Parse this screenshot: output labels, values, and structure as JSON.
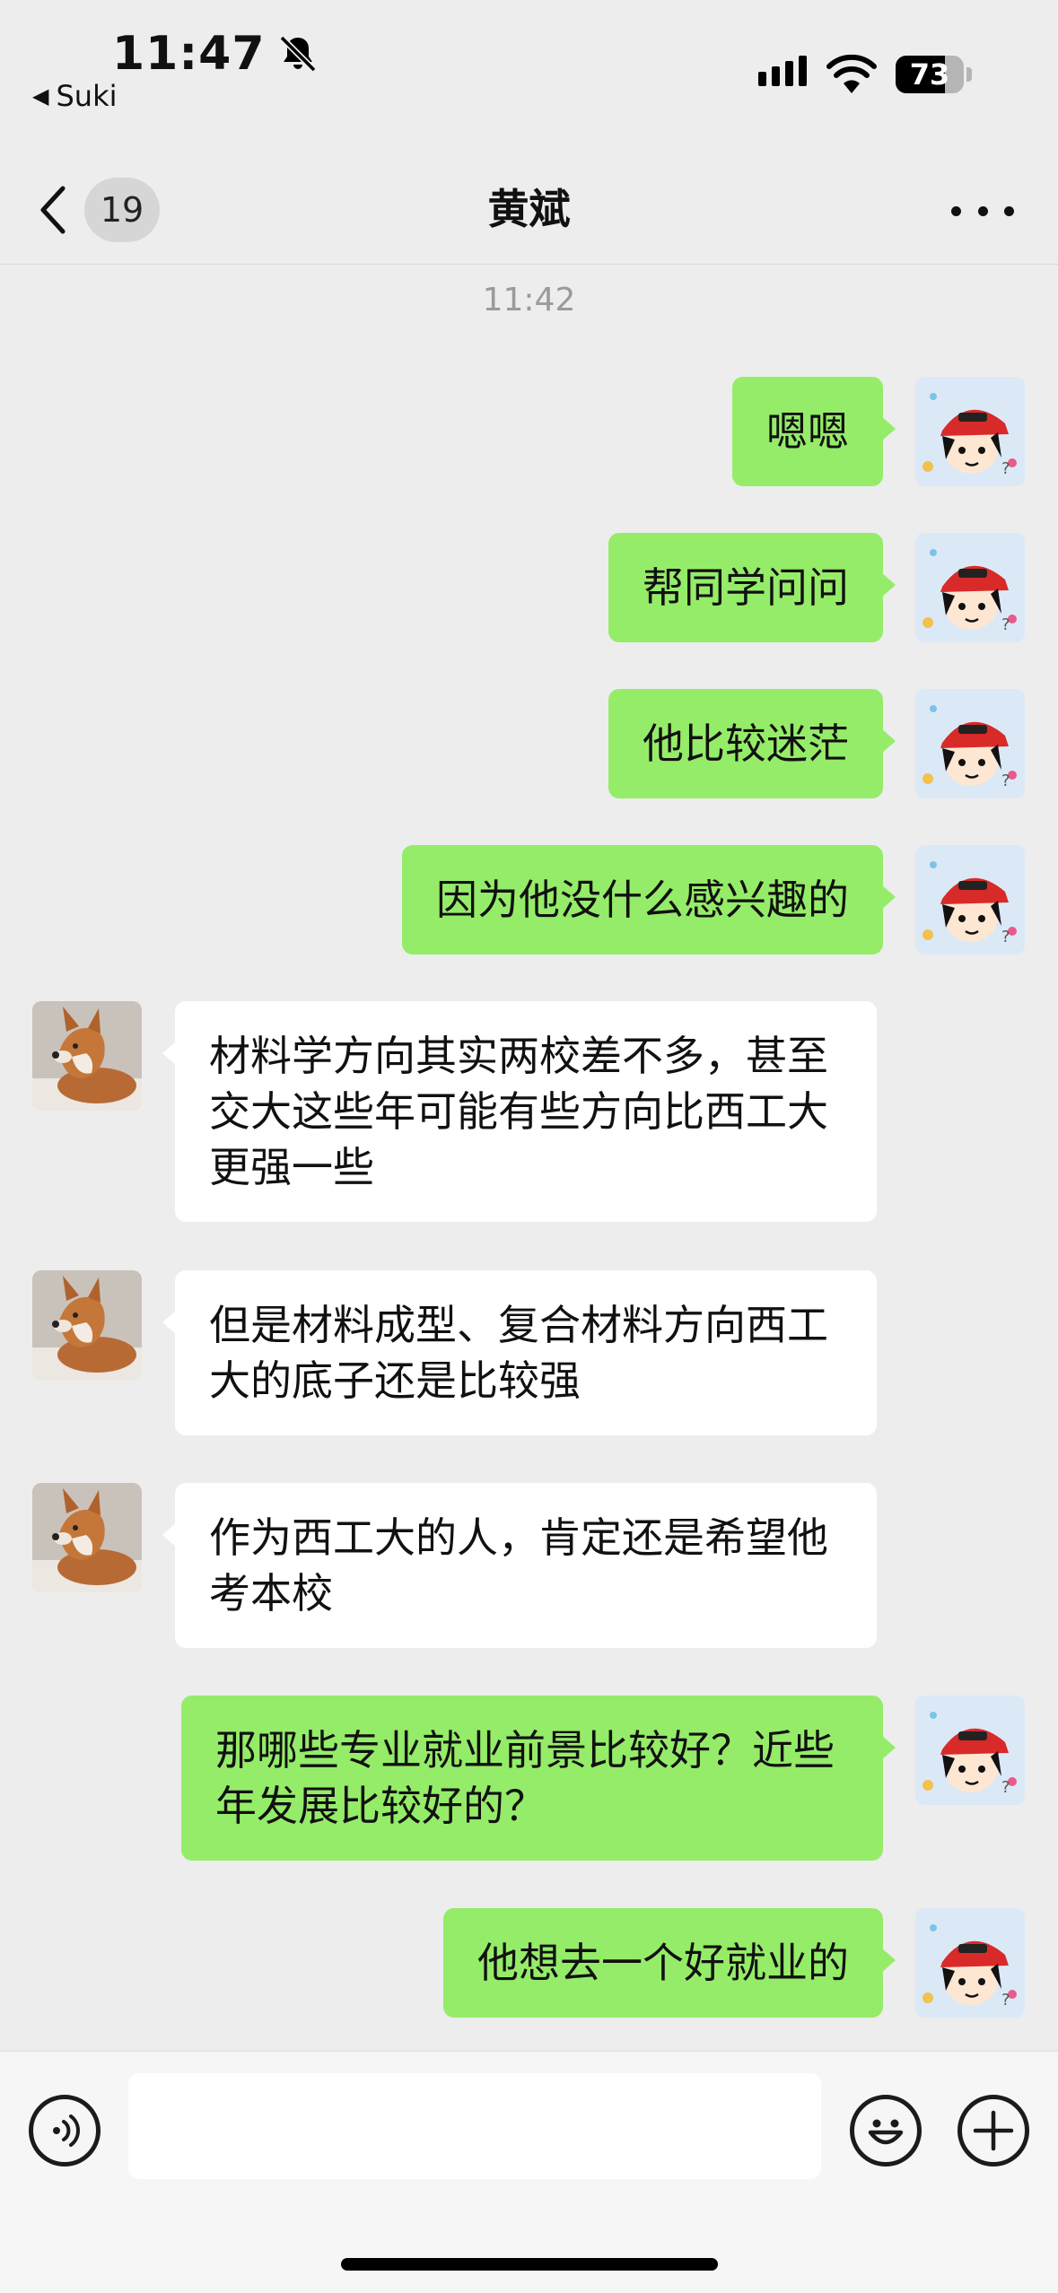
{
  "status_bar": {
    "time": "11:47",
    "back_app": "Suki",
    "battery_percent": 73
  },
  "nav": {
    "unread_count": "19",
    "title": "黄斌"
  },
  "chat": {
    "timestamp": "11:42",
    "messages": [
      {
        "side": "right",
        "text": "嗯嗯"
      },
      {
        "side": "right",
        "text": "帮同学问问"
      },
      {
        "side": "right",
        "text": "他比较迷茫"
      },
      {
        "side": "right",
        "text": "因为他没什么感兴趣的"
      },
      {
        "side": "left",
        "text": "材料学方向其实两校差不多，甚至交大这些年可能有些方向比西工大更强一些"
      },
      {
        "side": "left",
        "text": "但是材料成型、复合材料方向西工大的底子还是比较强"
      },
      {
        "side": "left",
        "text": "作为西工大的人，肯定还是希望他考本校"
      },
      {
        "side": "right",
        "text": "那哪些专业就业前景比较好？近些年发展比较好的？"
      },
      {
        "side": "right",
        "text": "他想去一个好就业的"
      }
    ]
  },
  "input": {
    "value": "",
    "placeholder": ""
  },
  "colors": {
    "sent_bubble": "#95ec69",
    "received_bubble": "#ffffff",
    "background": "#ededed"
  },
  "icons": {
    "back": "chevron-left-icon",
    "more": "more-dots-icon",
    "voice": "voice-icon",
    "emoji": "emoji-icon",
    "plus": "plus-icon",
    "mute": "bell-slash-icon"
  }
}
